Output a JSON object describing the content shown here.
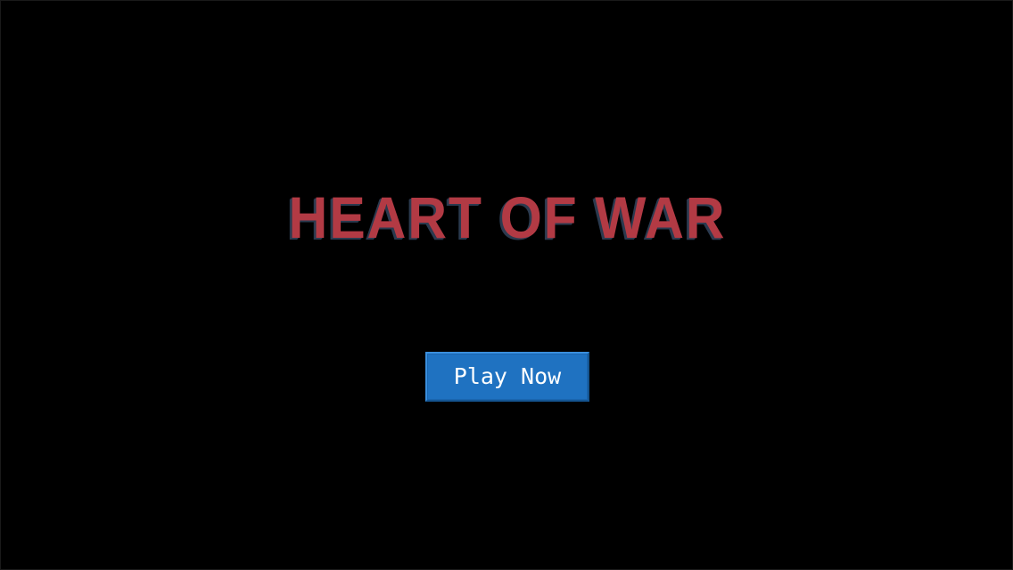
{
  "title": {
    "text": "HEART OF WAR",
    "color": "#b23a44",
    "shadow_color": "#2b3a4f"
  },
  "play_button": {
    "label": "Play Now",
    "color": "#1f72c1"
  },
  "background_color": "#000000"
}
